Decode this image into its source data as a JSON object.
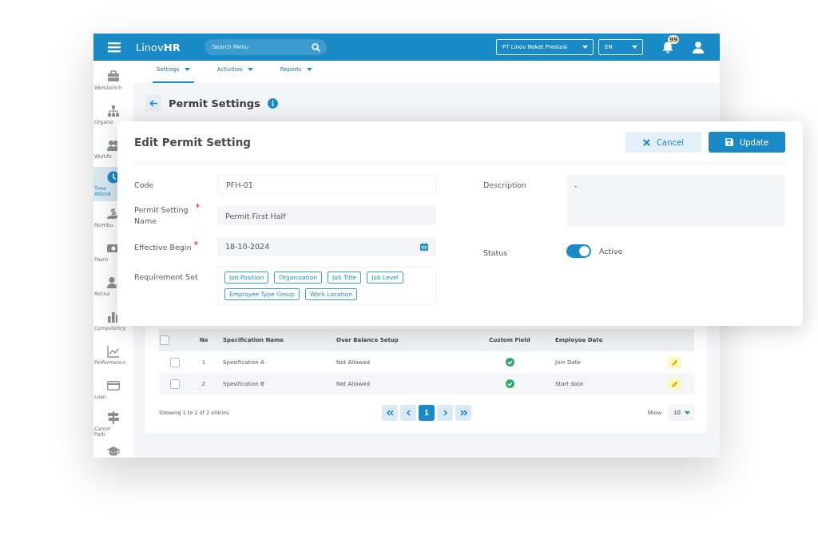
{
  "app": {
    "logo_plain": "Linov",
    "logo_bold": "HR",
    "search": {
      "placeholder": "Search Menu"
    },
    "company": "PT Linov Roket Prestasi",
    "language": "EN",
    "notifications": "99"
  },
  "sidebar": {
    "items": [
      {
        "label": "Workbench",
        "selected": false
      },
      {
        "label": "Organiz",
        "selected": false
      },
      {
        "label": "Workfo",
        "selected": false
      },
      {
        "label": "Time Attend",
        "selected": true
      },
      {
        "label": "Reimbu",
        "selected": false
      },
      {
        "label": "Payro",
        "selected": false
      },
      {
        "label": "Recrui",
        "selected": false
      },
      {
        "label": "Competency",
        "selected": false
      },
      {
        "label": "Performance",
        "selected": false
      },
      {
        "label": "Loan",
        "selected": false
      },
      {
        "label": "Career Path",
        "selected": false
      },
      {
        "selected": false
      }
    ]
  },
  "tabs": [
    {
      "label": "Settings",
      "selected": true
    },
    {
      "label": "Activities",
      "selected": false
    },
    {
      "label": "Reports",
      "selected": false
    }
  ],
  "page_title": "Permit Settings",
  "table": {
    "select_all_checked": false,
    "columns": [
      "No",
      "Specification Name",
      "Over Balance Setup",
      "Custom Field",
      "Employee Date"
    ],
    "rows": [
      {
        "checked": false,
        "no": "1",
        "name": "Spesification A",
        "over_balance": "Not Allowed",
        "custom_field": true,
        "employee_date": "Join Date"
      },
      {
        "checked": false,
        "no": "2",
        "name": "Spesification B",
        "over_balance": "Not Allowed",
        "custom_field": true,
        "employee_date": "Start date"
      }
    ]
  },
  "footer": {
    "summary": "Showing 1 to 2 of 2 entries",
    "pages": [
      {
        "label": "1",
        "selected": true
      }
    ],
    "show_label": "Show",
    "page_size": "10"
  },
  "modal": {
    "title": "Edit Permit Setting",
    "buttons": [
      {
        "kind": "cancel",
        "label": "Cancel"
      },
      {
        "kind": "update",
        "label": "Update"
      }
    ],
    "code": {
      "label": "Code",
      "value": "PFH-01",
      "required": false
    },
    "name": {
      "label": "Permit Setting Name",
      "value": "Permit First Half",
      "required": true
    },
    "effective_begin": {
      "label": "Effective Begin",
      "value": "18-10-2024",
      "required": true
    },
    "requirement_set": {
      "label": "Requirement Set",
      "tags": [
        "Job Position",
        "Organization",
        "Job Title",
        "Job Level",
        "Employee Type Group",
        "Work Location"
      ]
    },
    "description": {
      "label": "Description",
      "value": "-"
    },
    "status": {
      "label": "Status",
      "on": true,
      "text": "Active"
    }
  }
}
